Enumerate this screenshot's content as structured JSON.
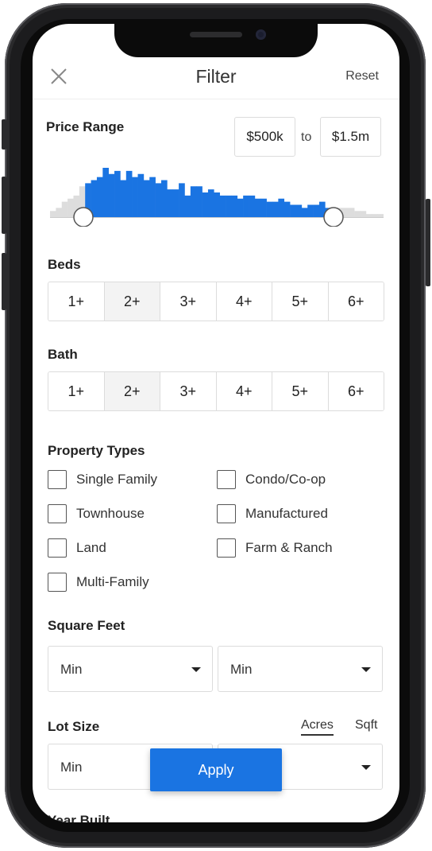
{
  "header": {
    "title": "Filter",
    "reset_label": "Reset"
  },
  "price_range": {
    "label": "Price Range",
    "min_value": "$500k",
    "to_text": "to",
    "max_value": "$1.5m",
    "selected_range_fraction": [
      0.1,
      0.85
    ],
    "histogram": {
      "bar_color": "#1a74e2",
      "out_of_range_color": "#dddddd",
      "bars": [
        2,
        3,
        5,
        6,
        7,
        10,
        11,
        12,
        13,
        16,
        14,
        15,
        12,
        15,
        13,
        14,
        12,
        13,
        11,
        12,
        9,
        9,
        11,
        7,
        10,
        10,
        8,
        9,
        8,
        7,
        7,
        7,
        6,
        7,
        7,
        6,
        6,
        5,
        5,
        6,
        5,
        4,
        4,
        3,
        4,
        4,
        5,
        3,
        2,
        3,
        3,
        3,
        2,
        2,
        1,
        1,
        1
      ]
    }
  },
  "beds": {
    "label": "Beds",
    "options": [
      "1+",
      "2+",
      "3+",
      "4+",
      "5+",
      "6+"
    ],
    "selected": "2+"
  },
  "bath": {
    "label": "Bath",
    "options": [
      "1+",
      "2+",
      "3+",
      "4+",
      "5+",
      "6+"
    ],
    "selected": "2+"
  },
  "property_types": {
    "label": "Property Types",
    "left": [
      "Single Family",
      "Townhouse",
      "Land",
      "Multi-Family"
    ],
    "right": [
      "Condo/Co-op",
      "Manufactured",
      "Farm & Ranch"
    ]
  },
  "square_feet": {
    "label": "Square Feet",
    "min_value": "Min",
    "max_value": "Min"
  },
  "lot_size": {
    "label": "Lot Size",
    "unit_acres": "Acres",
    "unit_sqft": "Sqft",
    "active_unit": "Acres",
    "min_value": "Min"
  },
  "apply_label": "Apply",
  "next_section_label": "Year Built",
  "colors": {
    "accent": "#1a74e2"
  }
}
